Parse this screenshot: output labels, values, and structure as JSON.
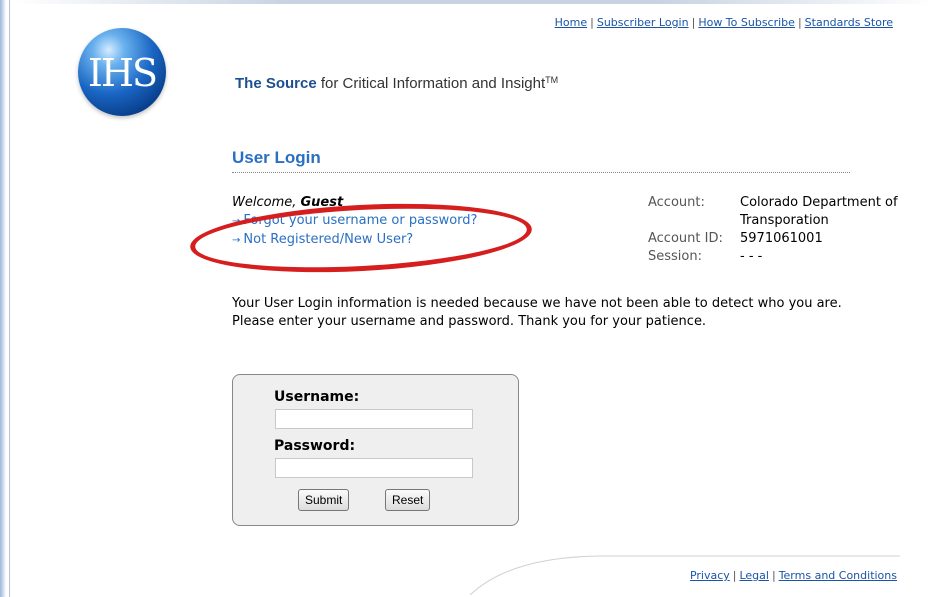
{
  "nav": {
    "links": [
      "Home",
      "Subscriber Login",
      "How To Subscribe",
      "Standards Store"
    ],
    "separator": "|"
  },
  "logo": {
    "text": "IHS"
  },
  "tagline": {
    "brand": "The Source",
    "rest": "for Critical Information and Insight",
    "tm": "TM"
  },
  "page": {
    "title": "User Login"
  },
  "welcome": {
    "prefix": "Welcome,",
    "name": "Guest"
  },
  "help_links": {
    "arrow": "→",
    "forgot": "Forgot your username or password?",
    "register": "Not Registered/New User?"
  },
  "account": {
    "account_label": "Account:",
    "account_value_line1": "Colorado Department of",
    "account_value_line2": "Transporation",
    "id_label": "Account ID:",
    "id_value": "5971061001",
    "session_label": "Session:",
    "session_value": "- - -"
  },
  "message": {
    "line1": "Your User Login information is needed because we have not been able to detect who you are.",
    "line2": "Please enter your username and password.  Thank you for your patience."
  },
  "form": {
    "username_label": "Username:",
    "username_value": "",
    "password_label": "Password:",
    "password_value": "",
    "submit_label": "Submit",
    "reset_label": "Reset"
  },
  "footer": {
    "links": [
      "Privacy",
      "Legal",
      "Terms and Conditions"
    ]
  },
  "colors": {
    "link": "#1a55a8",
    "heading": "#2a6fc4",
    "annotation": "#d61e1e",
    "brand": "#1d4f91"
  }
}
